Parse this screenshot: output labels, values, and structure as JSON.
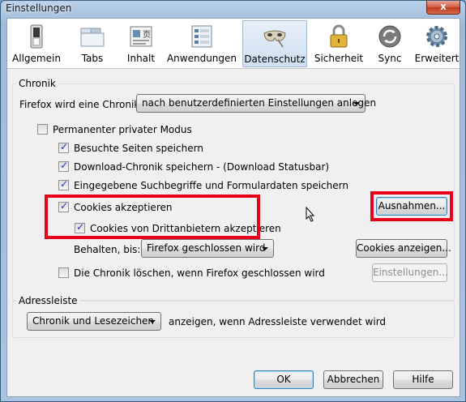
{
  "window": {
    "title": "Einstellungen",
    "close_glyph": "x"
  },
  "toolbar": {
    "panes": [
      {
        "label": "Allgemein",
        "icon": "switch-icon"
      },
      {
        "label": "Tabs",
        "icon": "tabs-icon"
      },
      {
        "label": "Inhalt",
        "icon": "content-icon"
      },
      {
        "label": "Anwendungen",
        "icon": "applications-icon"
      },
      {
        "label": "Datenschutz",
        "icon": "privacy-mask-icon",
        "selected": true
      },
      {
        "label": "Sicherheit",
        "icon": "padlock-icon"
      },
      {
        "label": "Sync",
        "icon": "sync-icon"
      },
      {
        "label": "Erweitert",
        "icon": "gear-icon"
      }
    ]
  },
  "history": {
    "group_title": "Chronik",
    "mode_label": "Firefox wird eine Chronik:",
    "mode_value": "nach benutzerdefinierten Einstellungen anlegen",
    "private_mode": {
      "label": "Permanenter privater Modus",
      "checked": false
    },
    "browsing_history": {
      "label": "Besuchte Seiten speichern",
      "checked": true
    },
    "download_history": {
      "label": "Download-Chronik speichern - (Download Statusbar)",
      "checked": true
    },
    "search_form_history": {
      "label": "Eingegebene Suchbegriffe und Formulardaten speichern",
      "checked": true
    },
    "accept_cookies": {
      "label": "Cookies akzeptieren",
      "checked": true
    },
    "third_party_cookies": {
      "label": "Cookies von Drittanbietern akzeptieren",
      "checked": true
    },
    "keep_until_label": "Behalten, bis:",
    "keep_until_value": "Firefox geschlossen wird",
    "exceptions_button": "Ausnahmen...",
    "show_cookies_button": "Cookies anzeigen...",
    "clear_on_close": {
      "label": "Die Chronik löschen, wenn Firefox geschlossen wird",
      "checked": false
    },
    "settings_button": "Einstellungen..."
  },
  "location_bar": {
    "group_title": "Adressleiste",
    "suggest_value": "Chronik und Lesezeichen",
    "suggest_suffix": "anzeigen, wenn Adressleiste verwendet wird"
  },
  "buttons": {
    "ok": "OK",
    "cancel": "Abbrechen",
    "help": "Hilfe"
  },
  "colors": {
    "highlight": "#e8001a",
    "selected_pane": "#cfdff1",
    "dialog_bg": "#f0f0f0"
  }
}
